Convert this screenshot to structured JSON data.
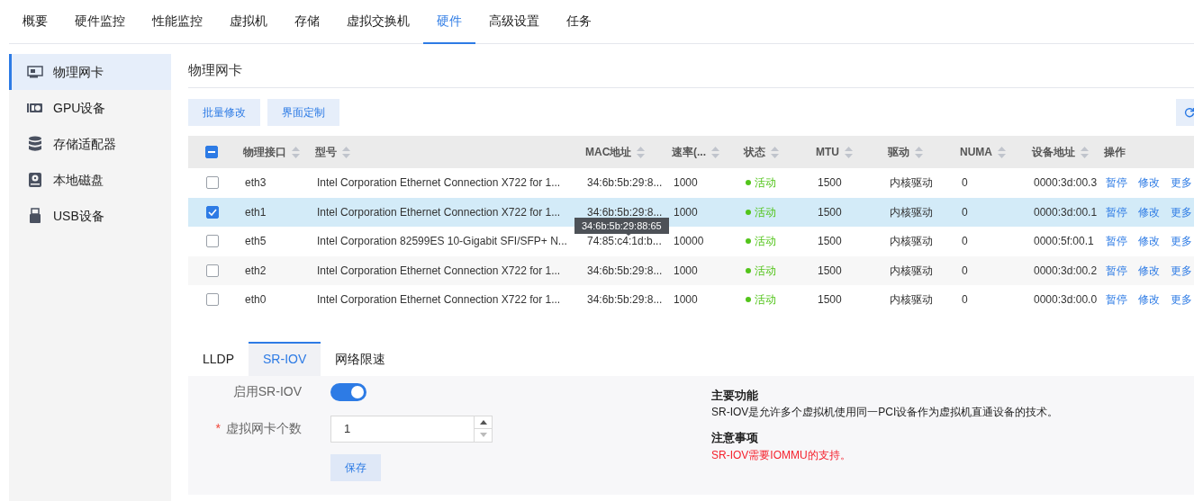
{
  "top_tabs": [
    {
      "label": "概要",
      "selected": false
    },
    {
      "label": "硬件监控",
      "selected": false
    },
    {
      "label": "性能监控",
      "selected": false
    },
    {
      "label": "虚拟机",
      "selected": false
    },
    {
      "label": "存储",
      "selected": false
    },
    {
      "label": "虚拟交换机",
      "selected": false
    },
    {
      "label": "硬件",
      "selected": true
    },
    {
      "label": "高级设置",
      "selected": false
    },
    {
      "label": "任务",
      "selected": false
    }
  ],
  "sidebar": {
    "items": [
      {
        "label": "物理网卡",
        "kind": "nic",
        "selected": true
      },
      {
        "label": "GPU设备",
        "kind": "gpu",
        "selected": false
      },
      {
        "label": "存储适配器",
        "kind": "storage",
        "selected": false
      },
      {
        "label": "本地磁盘",
        "kind": "disk",
        "selected": false
      },
      {
        "label": "USB设备",
        "kind": "usb",
        "selected": false
      }
    ]
  },
  "page_title": "物理网卡",
  "toolbar": {
    "buttons": [
      "批量修改",
      "界面定制"
    ]
  },
  "table": {
    "select_all_partial": true,
    "columns": [
      {
        "label": "物理接口",
        "sortable": true
      },
      {
        "label": "型号",
        "sortable": true
      },
      {
        "label": "MAC地址",
        "sortable": true
      },
      {
        "label": "速率(...",
        "sortable": true
      },
      {
        "label": "状态",
        "sortable": true
      },
      {
        "label": "MTU",
        "sortable": true
      },
      {
        "label": "驱动",
        "sortable": true
      },
      {
        "label": "NUMA",
        "sortable": true
      },
      {
        "label": "设备地址",
        "sortable": true
      },
      {
        "label": "操作",
        "sortable": false
      }
    ],
    "rows": [
      {
        "selected": false,
        "checked": false,
        "interface": "eth3",
        "model": "Intel Corporation Ethernet Connection X722 for 1...",
        "mac": "34:6b:5b:29:8...",
        "speed": "1000",
        "status": "活动",
        "mtu": "1500",
        "driver": "内核驱动",
        "numa": "0",
        "address": "0000:3d:00.3",
        "actions": [
          "暂停",
          "修改",
          "更多"
        ]
      },
      {
        "selected": true,
        "checked": true,
        "interface": "eth1",
        "model": "Intel Corporation Ethernet Connection X722 for 1...",
        "mac": "34:6b:5b:29:8...",
        "speed": "1000",
        "status": "活动",
        "mtu": "1500",
        "driver": "内核驱动",
        "numa": "0",
        "address": "0000:3d:00.1",
        "actions": [
          "暂停",
          "修改",
          "更多"
        ],
        "tooltip": "34:6b:5b:29:88:65"
      },
      {
        "selected": false,
        "checked": false,
        "interface": "eth5",
        "model": "Intel Corporation 82599ES 10-Gigabit SFI/SFP+ N...",
        "mac": "74:85:c4:1d:b...",
        "speed": "10000",
        "status": "活动",
        "mtu": "1500",
        "driver": "内核驱动",
        "numa": "0",
        "address": "0000:5f:00.1",
        "actions": [
          "暂停",
          "修改",
          "更多"
        ]
      },
      {
        "selected": false,
        "checked": false,
        "interface": "eth2",
        "model": "Intel Corporation Ethernet Connection X722 for 1...",
        "mac": "34:6b:5b:29:8...",
        "speed": "1000",
        "status": "活动",
        "mtu": "1500",
        "driver": "内核驱动",
        "numa": "0",
        "address": "0000:3d:00.2",
        "actions": [
          "暂停",
          "修改",
          "更多"
        ]
      },
      {
        "selected": false,
        "checked": false,
        "interface": "eth0",
        "model": "Intel Corporation Ethernet Connection X722 for 1...",
        "mac": "34:6b:5b:29:8...",
        "speed": "1000",
        "status": "活动",
        "mtu": "1500",
        "driver": "内核驱动",
        "numa": "0",
        "address": "0000:3d:00.0",
        "actions": [
          "暂停",
          "修改",
          "更多"
        ]
      }
    ]
  },
  "detail_tabs": [
    {
      "label": "LLDP",
      "selected": false
    },
    {
      "label": "SR-IOV",
      "selected": true
    },
    {
      "label": "网络限速",
      "selected": false
    }
  ],
  "sriov": {
    "enable_label": "启用SR-IOV",
    "enabled": true,
    "count_label": "虚拟网卡个数",
    "required_mark": "*",
    "count_value": "1",
    "save_button": "保存"
  },
  "info": [
    {
      "heading": "主要功能",
      "text": "SR-IOV是允许多个虚拟机使用同一PCI设备作为虚拟机直通设备的技术。",
      "warning": false
    },
    {
      "heading": "注意事项",
      "text": "SR-IOV需要IOMMU的支持。",
      "warning": true
    }
  ]
}
